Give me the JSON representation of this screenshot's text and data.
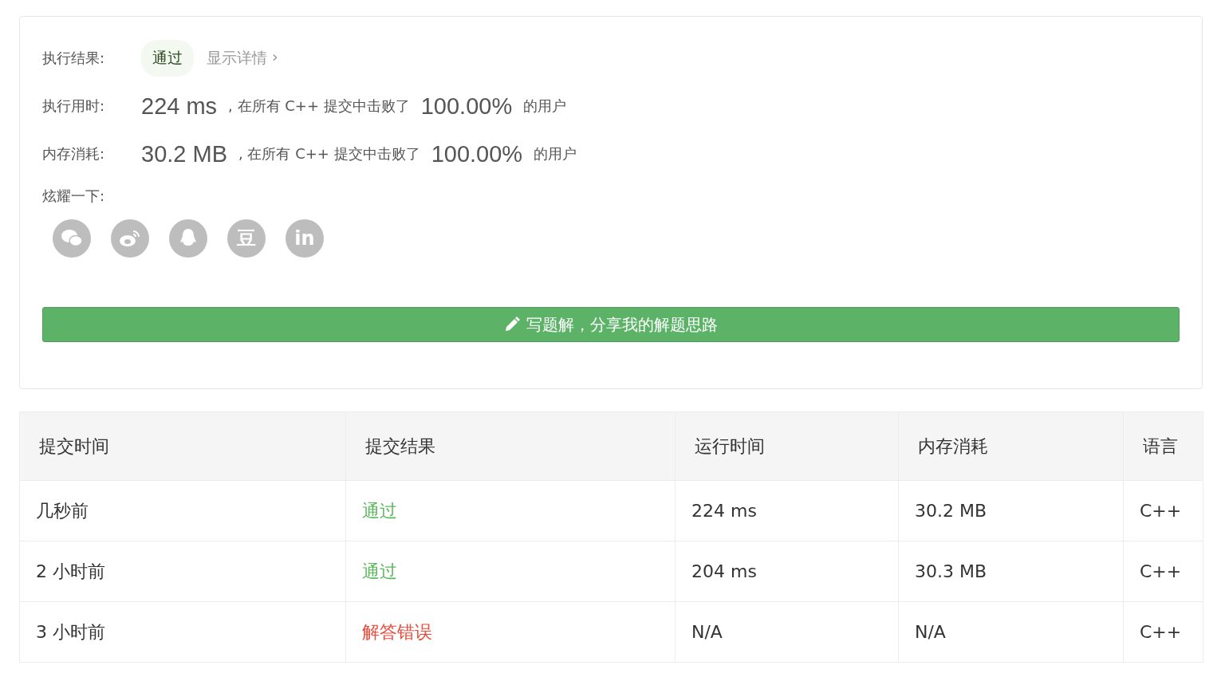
{
  "result": {
    "label": "执行结果:",
    "badge": "通过",
    "kind": "pass",
    "details_link": "显示详情",
    "details_arrow": "›"
  },
  "stats": [
    {
      "label": "执行用时:",
      "value": "224 ms",
      "phrase": ", 在所有 C++ 提交中击败了",
      "percent": "100.00%",
      "suffix": "的用户"
    },
    {
      "label": "内存消耗:",
      "value": "30.2 MB",
      "phrase": ", 在所有 C++ 提交中击败了",
      "percent": "100.00%",
      "suffix": "的用户"
    }
  ],
  "share": {
    "label": "炫耀一下:",
    "buttons": [
      {
        "kind": "wechat"
      },
      {
        "kind": "weibo"
      },
      {
        "kind": "qq"
      },
      {
        "kind": "douban",
        "text": "豆"
      },
      {
        "kind": "linkedin",
        "text": "in"
      }
    ]
  },
  "write_button": "写题解，分享我的解题思路",
  "table": {
    "columns": [
      "提交时间",
      "提交结果",
      "运行时间",
      "内存消耗",
      "语言"
    ],
    "rows": [
      {
        "time": "几秒前",
        "result": "通过",
        "kind": "pass",
        "runtime": "224 ms",
        "memory": "30.2 MB",
        "language": "C++"
      },
      {
        "time": "2 小时前",
        "result": "通过",
        "kind": "pass",
        "runtime": "204 ms",
        "memory": "30.3 MB",
        "language": "C++"
      },
      {
        "time": "3 小时前",
        "result": "解答错误",
        "kind": "fail",
        "runtime": "N/A",
        "memory": "N/A",
        "language": "C++"
      }
    ]
  }
}
